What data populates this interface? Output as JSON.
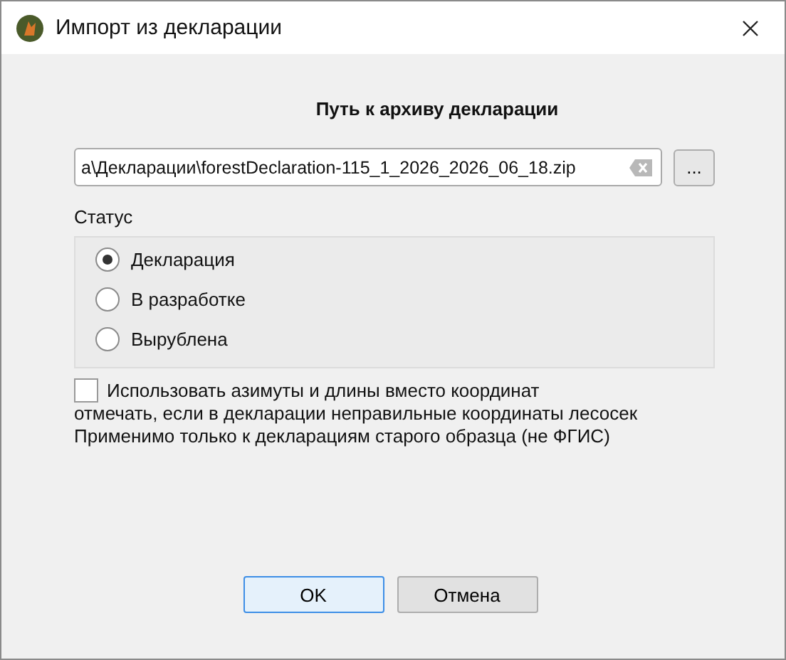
{
  "window": {
    "title": "Импорт из декларации"
  },
  "heading": "Путь к архиву декларации",
  "path_field": {
    "value": "а\\Декларации\\forestDeclaration-115_1_2026_2026_06_18.zip"
  },
  "browse_button": "...",
  "status": {
    "label": "Статус",
    "options": [
      {
        "label": "Декларация",
        "selected": true
      },
      {
        "label": "В разработке",
        "selected": false
      },
      {
        "label": "Вырублена",
        "selected": false
      }
    ]
  },
  "azimuth_checkbox": {
    "label": "Использовать азимуты и длины вместо координат",
    "checked": false
  },
  "notes": [
    "отмечать, если в декларации неправильные координаты лесосек",
    "Применимо только к декларациям старого образца (не ФГИС)"
  ],
  "buttons": [
    {
      "label": "OK",
      "kind": "default"
    },
    {
      "label": "Отмена",
      "kind": "normal"
    }
  ]
}
